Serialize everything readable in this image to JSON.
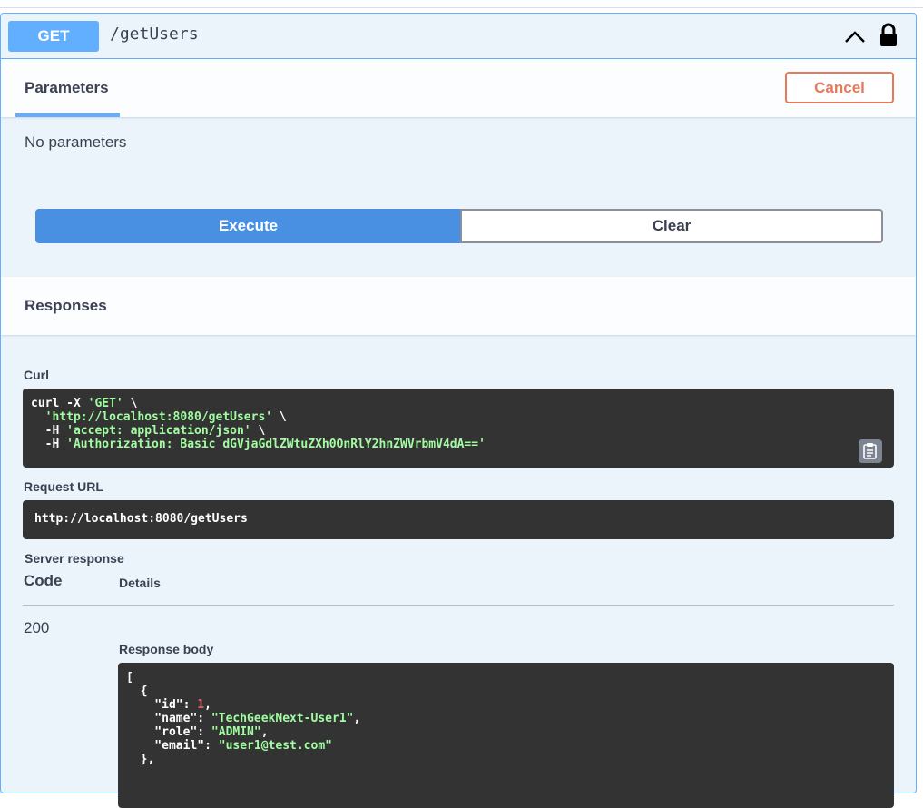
{
  "endpoint": {
    "method": "GET",
    "path": "/getUsers"
  },
  "tabs": {
    "parameters_label": "Parameters",
    "cancel_label": "Cancel"
  },
  "parameters": {
    "empty_text": "No parameters"
  },
  "actions": {
    "execute_label": "Execute",
    "clear_label": "Clear"
  },
  "responses": {
    "title": "Responses",
    "curl_label": "Curl",
    "curl_lines": [
      [
        "curl -X ",
        "'GET'",
        " \\"
      ],
      [
        "  ",
        "'http://localhost:8080/getUsers'",
        " \\"
      ],
      [
        "  -H ",
        "'accept: application/json'",
        " \\"
      ],
      [
        "  -H ",
        "'Authorization: Basic dGVjaGdlZWtuZXh0OnRlY2hnZWVrbmV4dA=='",
        ""
      ]
    ],
    "request_url_label": "Request URL",
    "request_url": "http://localhost:8080/getUsers",
    "server_response_label": "Server response",
    "code_header": "Code",
    "details_header": "Details",
    "status_code": "200",
    "response_body_label": "Response body",
    "response_body": {
      "id": "1",
      "name": "\"TechGeekNext-User1\"",
      "role": "\"ADMIN\"",
      "email": "\"user1@test.com\""
    }
  },
  "icons": {
    "collapse": "chevron-up-icon",
    "lock": "lock-icon",
    "copy": "clipboard-copy-icon"
  },
  "colors": {
    "get": "#61affe",
    "execute": "#4990e2",
    "cancel": "#e6795a",
    "code_bg": "#333333",
    "string": "#a2fca2",
    "number": "#d36363"
  }
}
